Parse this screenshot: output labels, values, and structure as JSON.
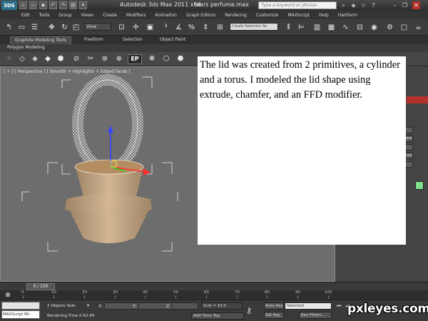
{
  "titlebar": {
    "app_logo": "3DS",
    "title": "Autodesk 3ds Max  2011 x64",
    "file": "tears perfume.max",
    "search_placeholder": "Type a keyword or phrase"
  },
  "menubar": {
    "items": [
      "Edit",
      "Tools",
      "Group",
      "Views",
      "Create",
      "Modifiers",
      "Animation",
      "Graph Editors",
      "Rendering",
      "Customize",
      "MAXScript",
      "Help",
      "HairFarm"
    ]
  },
  "maintoolbar": {
    "view_dropdown": "View",
    "selection_set_placeholder": "Create Selection Se"
  },
  "ribbon": {
    "tabs": [
      "Graphite Modeling Tools",
      "Freeform",
      "Selection",
      "Object Paint"
    ],
    "panel_label": "Polygon Modeling",
    "ep_badge": "EP",
    "ep_small": "Convert"
  },
  "viewport": {
    "label": "[ + ] [ Perspective ] [ Smooth + Highlights + Edged Faces ]"
  },
  "command_panel": {
    "buttons": [
      "ne",
      "phere",
      "be",
      "ramid",
      "ne"
    ]
  },
  "caption": {
    "text": "The lid was created from 2 primitives, a cylinder and a torus. I modeled the lid shape using extrude, chamfer, and an FFD modifier."
  },
  "timeline": {
    "frame_display": "0 / 100",
    "ticks": [
      "0",
      "10",
      "20",
      "30",
      "40",
      "50",
      "60",
      "70",
      "80",
      "90",
      "100"
    ]
  },
  "statusbar": {
    "maxscript": "MAXScript Mi:",
    "selection_status": "2 Objects Sele",
    "render_time": "Rendering Time  0:42:49",
    "x_label": "X:",
    "y_label": "Y:",
    "z_label": "Z:",
    "grid": "Grid = 10.0",
    "add_time_tag": "Add Time Tag",
    "auto_key": "Auto Key",
    "selected": "Selected",
    "set_key": "Set Key",
    "key_filters": "Key Filters..."
  },
  "watermark": "pxleyes.com"
}
